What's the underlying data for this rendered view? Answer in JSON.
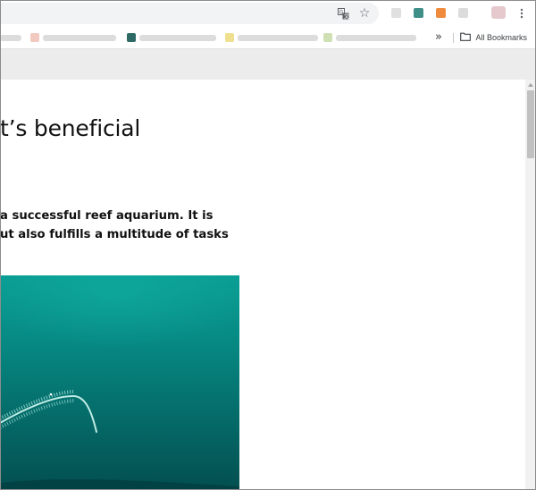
{
  "browser": {
    "icons": {
      "translate": "translate-icon",
      "bookmark": "star-icon",
      "menu": "kebab-menu-icon"
    },
    "extensions_overflow": "»",
    "all_bookmarks_label": "All Bookmarks"
  },
  "article": {
    "heading": "t’s beneficial",
    "intro_line1": "a successful reef aquarium. It is",
    "intro_line2": "ut also fulfills a multitude of tasks"
  },
  "colors": {
    "photo_top": "#0a9d93",
    "photo_bottom": "#034f50",
    "banner": "#ececec"
  }
}
